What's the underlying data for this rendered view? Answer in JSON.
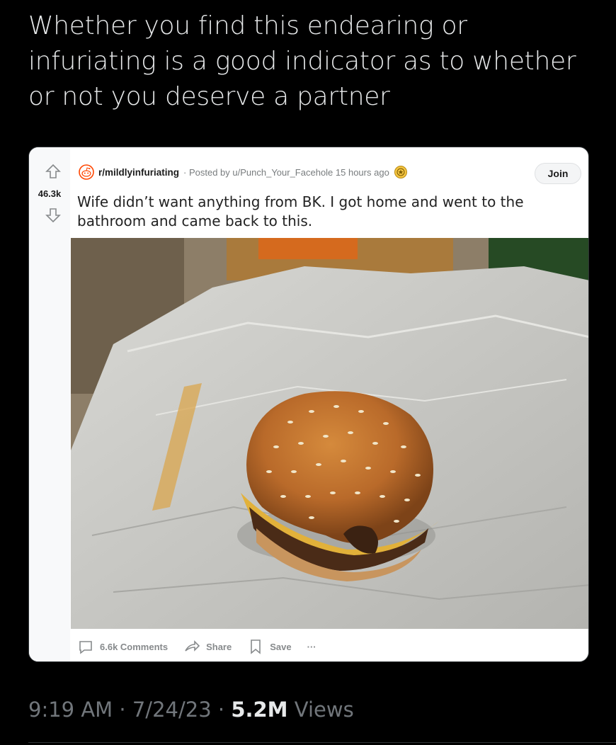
{
  "tweet": {
    "text": "Whether you find this endearing or infuriating is a good indicator as to whether or not you deserve a partner",
    "time": "9:19 AM",
    "date": "7/24/23",
    "views_count": "5.2M",
    "views_label": "Views",
    "separator": "·"
  },
  "reddit_post": {
    "subreddit": "r/mildlyinfuriating",
    "posted_by": "· Posted by u/Punch_Your_Facehole 15 hours ago",
    "join_label": "Join",
    "score": "46.3k",
    "title": "Wife didn’t want anything from BK. I got home and went to the bathroom and came back to this.",
    "actions": {
      "comments": "6.6k Comments",
      "share": "Share",
      "save": "Save",
      "more": "···"
    }
  },
  "colors": {
    "background": "#000000",
    "card": "#ffffff",
    "reddit_orange": "#ff4500"
  }
}
